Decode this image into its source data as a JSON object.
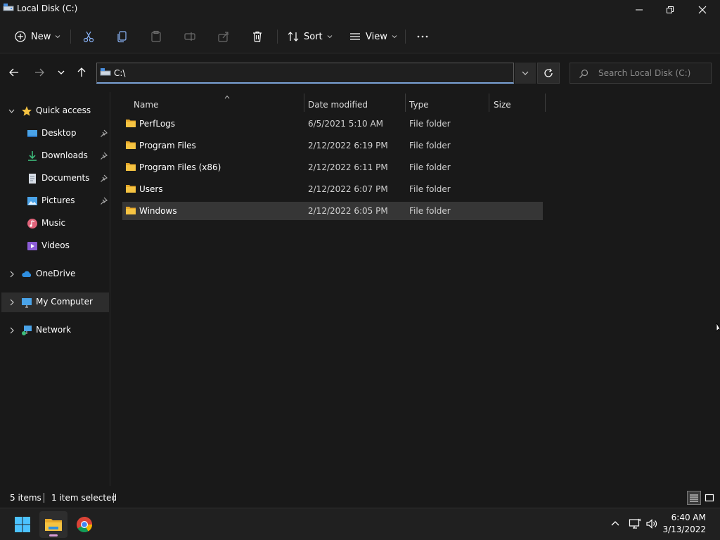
{
  "window": {
    "title": "Local Disk (C:)"
  },
  "commandbar": {
    "new_label": "New",
    "sort_label": "Sort",
    "view_label": "View",
    "more_label": "···"
  },
  "address": {
    "path": "C:\\",
    "search_placeholder": "Search Local Disk (C:)"
  },
  "sidebar": {
    "quick_access": "Quick access",
    "pinned": [
      {
        "label": "Desktop",
        "icon": "desktop-icon"
      },
      {
        "label": "Downloads",
        "icon": "downloads-icon"
      },
      {
        "label": "Documents",
        "icon": "documents-icon"
      },
      {
        "label": "Pictures",
        "icon": "pictures-icon"
      }
    ],
    "unpinned": [
      {
        "label": "Music",
        "icon": "music-icon"
      },
      {
        "label": "Videos",
        "icon": "videos-icon"
      }
    ],
    "onedrive": "OneDrive",
    "my_computer": "My Computer",
    "network": "Network"
  },
  "columns": {
    "name": "Name",
    "date": "Date modified",
    "type": "Type",
    "size": "Size"
  },
  "files": [
    {
      "name": "PerfLogs",
      "date": "6/5/2021 5:10 AM",
      "type": "File folder",
      "selected": false
    },
    {
      "name": "Program Files",
      "date": "2/12/2022 6:19 PM",
      "type": "File folder",
      "selected": false
    },
    {
      "name": "Program Files (x86)",
      "date": "2/12/2022 6:11 PM",
      "type": "File folder",
      "selected": false
    },
    {
      "name": "Users",
      "date": "2/12/2022 6:07 PM",
      "type": "File folder",
      "selected": false
    },
    {
      "name": "Windows",
      "date": "2/12/2022 6:05 PM",
      "type": "File folder",
      "selected": true
    }
  ],
  "status": {
    "items": "5 items",
    "selected": "1 item selected"
  },
  "taskbar": {
    "time": "6:40 AM",
    "date": "3/13/2022"
  },
  "colors": {
    "folder": "#f5c342",
    "accent": "#7aa2d6",
    "selection": "#363636"
  }
}
